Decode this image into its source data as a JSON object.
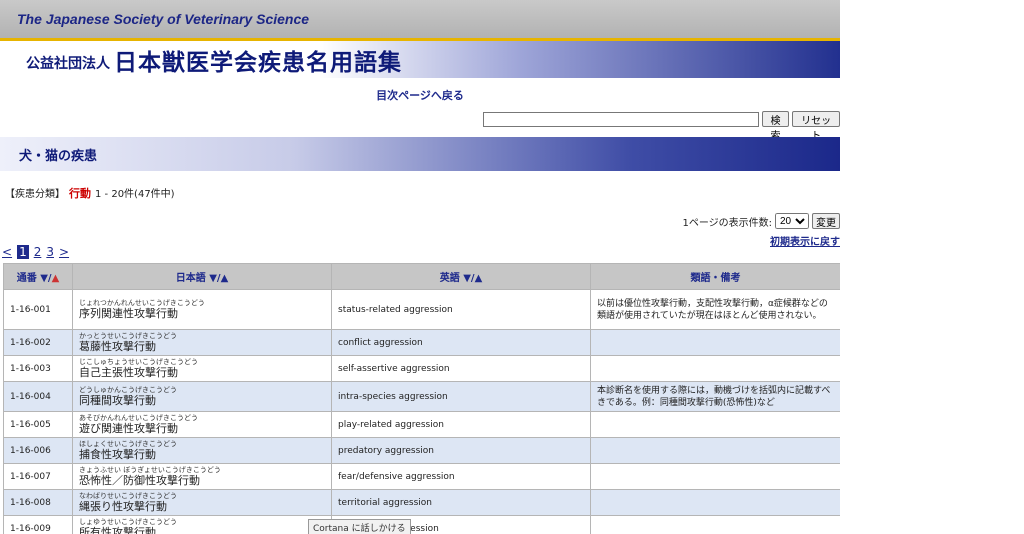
{
  "header": {
    "society_title": "The Japanese Society of Veterinary Science",
    "banner_small": "公益社団法人",
    "banner_main": "日本獣医学会疾患名用語集"
  },
  "nav": {
    "back_link": "目次ページへ戻る"
  },
  "search": {
    "value": "",
    "search_button": "検索",
    "reset_button": "リセット"
  },
  "section": {
    "title": "犬・猫の疾患"
  },
  "filter": {
    "label": "【疾患分類】",
    "value": "行動",
    "range": "1 - 20件(47件中)"
  },
  "display": {
    "per_page_label": "1ページの表示件数:",
    "per_page_value": "20",
    "change_button": "変更",
    "reset_link": "初期表示に戻す"
  },
  "pagination": {
    "prev": "<",
    "pages": [
      "1",
      "2",
      "3"
    ],
    "current": "1",
    "next": ">"
  },
  "table": {
    "headers": {
      "no": "通番",
      "ja": "日本語",
      "en": "英語",
      "notes": "類語・備考"
    },
    "rows": [
      {
        "no": "1-16-001",
        "ruby": "じょれつかんれんせいこうげきこうどう",
        "ja": "序列関連性攻撃行動",
        "en": "status-related aggression",
        "notes": "以前は優位性攻撃行動，支配性攻撃行動，α症候群などの類語が使用されていたが現在はほとんど使用されない。"
      },
      {
        "no": "1-16-002",
        "ruby": "かっとうせいこうげきこうどう",
        "ja": "葛藤性攻撃行動",
        "en": "conflict aggression",
        "notes": ""
      },
      {
        "no": "1-16-003",
        "ruby": "じこしゅちょうせいこうげきこうどう",
        "ja": "自己主張性攻撃行動",
        "en": "self-assertive aggression",
        "notes": ""
      },
      {
        "no": "1-16-004",
        "ruby": "どうしゅかんこうげきこうどう",
        "ja": "同種間攻撃行動",
        "en": "intra-species aggression",
        "notes": "本診断名を使用する際には，動機づけを括弧内に記載すべきである。例：同種間攻撃行動(恐怖性)など"
      },
      {
        "no": "1-16-005",
        "ruby": "あそびかんれんせいこうげきこうどう",
        "ja": "遊び関連性攻撃行動",
        "en": "play-related aggression",
        "notes": ""
      },
      {
        "no": "1-16-006",
        "ruby": "ほしょくせいこうげきこうどう",
        "ja": "捕食性攻撃行動",
        "en": "predatory aggression",
        "notes": ""
      },
      {
        "no": "1-16-007",
        "ruby": "きょうふせい ぼうぎょせいこうげきこうどう",
        "ja": "恐怖性／防御性攻撃行動",
        "en": "fear/defensive aggression",
        "notes": ""
      },
      {
        "no": "1-16-008",
        "ruby": "なわばりせいこうげきこうどう",
        "ja": "縄張り性攻撃行動",
        "en": "territorial aggression",
        "notes": ""
      },
      {
        "no": "1-16-009",
        "ruby": "しょゆうせいこうげきこうどう",
        "ja": "所有性攻撃行動",
        "en": "possessive aggression",
        "notes": ""
      }
    ]
  },
  "overlay": {
    "cortana": "Cortana に話しかける"
  },
  "colors": {
    "accent": "#1e2a8c",
    "highlight": "#cc0000",
    "gold_rule": "#e7b400",
    "row_alt": "#dde6f4"
  }
}
